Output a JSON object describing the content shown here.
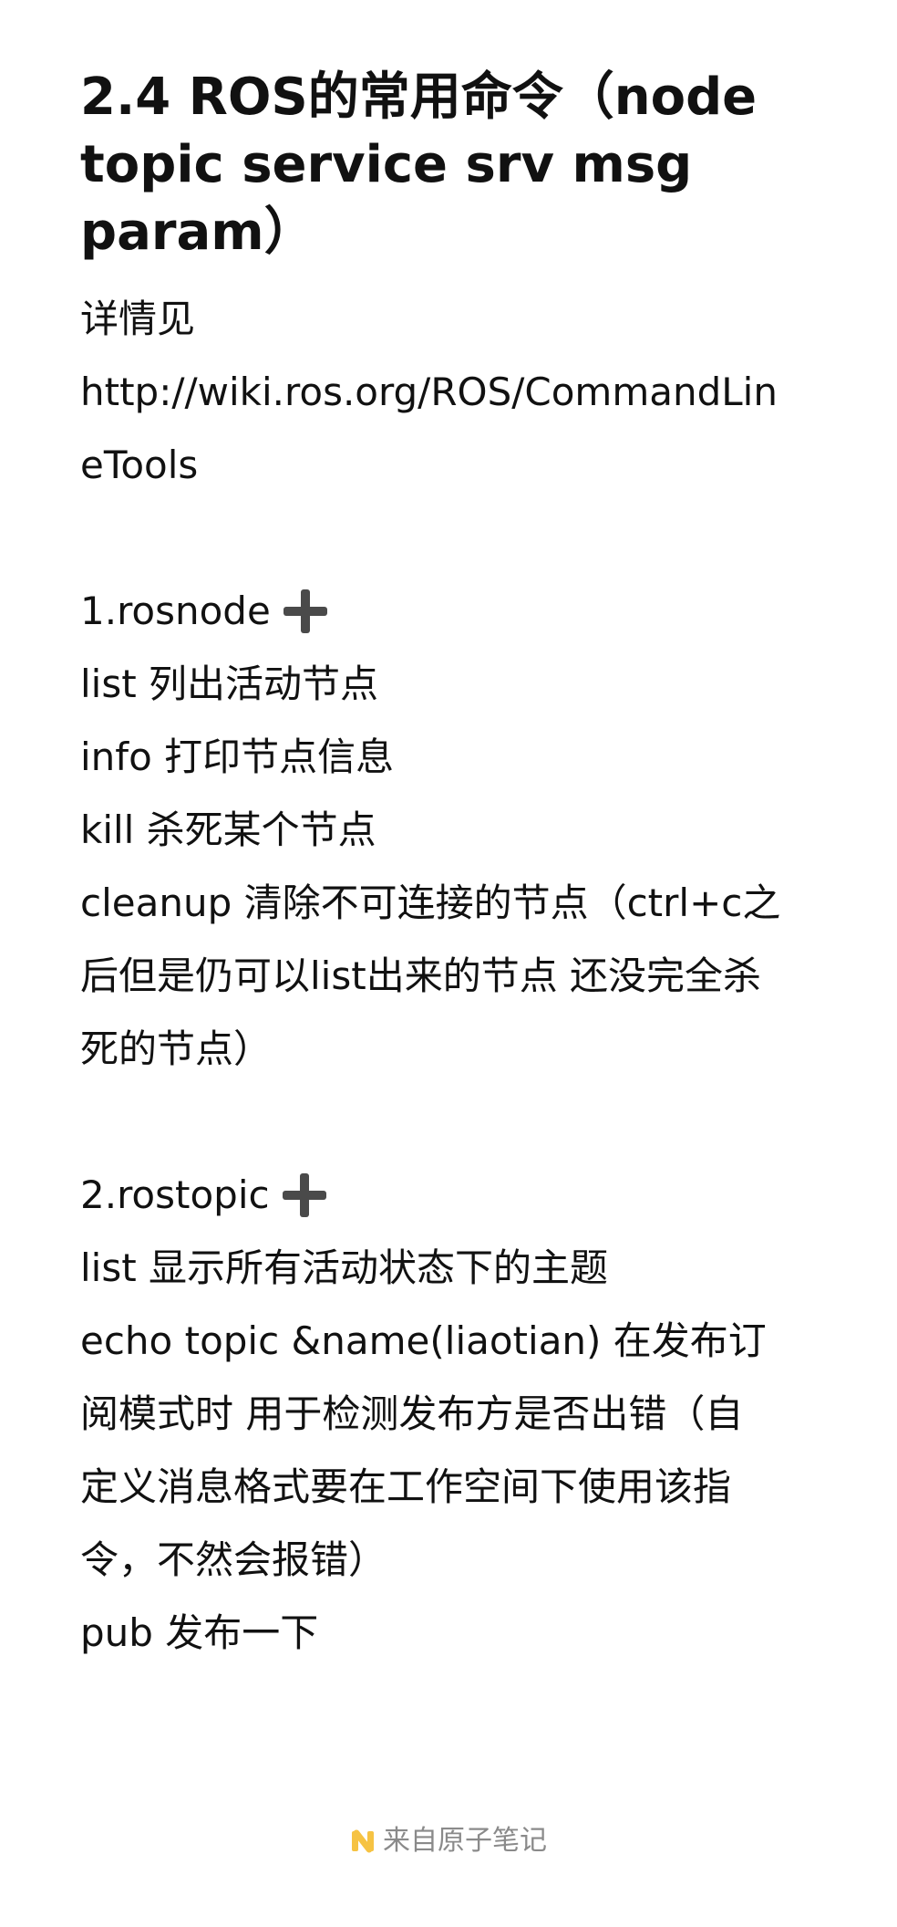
{
  "note": {
    "title_lines": [
      "2.4 ROS的常用命令（node",
      "topic service srv msg",
      "param）"
    ],
    "intro_lines": [
      "详情见",
      "http://wiki.ros.org/ROS/CommandLin",
      "eTools"
    ],
    "sections": [
      {
        "heading": "1.rosnode",
        "icon": "plus-icon",
        "lines": [
          "list 列出活动节点",
          "info 打印节点信息",
          "kill 杀死某个节点",
          "cleanup 清除不可连接的节点（ctrl+c之",
          "后但是仍可以list出来的节点 还没完全杀",
          "死的节点）"
        ]
      },
      {
        "heading": "2.rostopic",
        "icon": "plus-icon",
        "lines": [
          "list 显示所有活动状态下的主题",
          "echo topic &name(liaotian) 在发布订",
          "阅模式时 用于检测发布方是否出错（自",
          "定义消息格式要在工作空间下使用该指",
          "令，不然会报错）",
          "pub 发布一下"
        ]
      }
    ]
  },
  "footer": {
    "logo_icon": "atom-note-logo-icon",
    "text": "来自原子笔记"
  },
  "colors": {
    "text": "#111111",
    "icon": "#4a4a4a",
    "footer_text": "#8a8a8a",
    "logo_yellow": "#f6c343"
  }
}
